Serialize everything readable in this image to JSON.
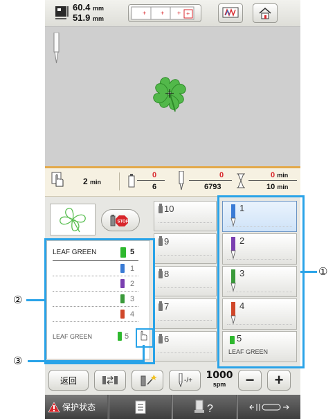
{
  "top_bar": {
    "width": "60.4",
    "height": "51.9",
    "unit": "mm"
  },
  "status_bar": {
    "time_value": "2",
    "time_unit": "min",
    "color_current": "0",
    "color_total": "6",
    "stitch_current": "0",
    "stitch_total": "6793",
    "remaining_current": "0",
    "remaining_unit_top": "min",
    "remaining_total": "10",
    "remaining_unit_bottom": "min"
  },
  "color_list": {
    "header_name": "LEAF GREEN",
    "header_num": "5",
    "rows": [
      {
        "num": "1",
        "color": "#3a7bd5"
      },
      {
        "num": "2",
        "color": "#7a3fb0"
      },
      {
        "num": "3",
        "color": "#3a9a3a"
      },
      {
        "num": "4",
        "color": "#d0472a"
      }
    ],
    "last_name": "LEAF GREEN",
    "last_num": "5"
  },
  "middle_column": [
    "10",
    "9",
    "8",
    "7",
    "6"
  ],
  "right_column": [
    {
      "num": "1",
      "color": "#3a7bd5",
      "label": ""
    },
    {
      "num": "2",
      "color": "#7a3fb0",
      "label": ""
    },
    {
      "num": "3",
      "color": "#3a9a3a",
      "label": ""
    },
    {
      "num": "4",
      "color": "#d0472a",
      "label": ""
    },
    {
      "num": "5",
      "color": "#2eb82e",
      "label": "LEAF GREEN"
    }
  ],
  "bottom_controls": {
    "back_label": "返回",
    "speed_value": "1000",
    "speed_unit": "spm",
    "needle_toggle_label": "-/+",
    "minus_label": "−",
    "plus_label": "+"
  },
  "bottom_bar": {
    "protect_label": "保护状态"
  },
  "callouts": {
    "c1": "①",
    "c2": "②",
    "c3": "③"
  },
  "colors": {
    "selection_blue": "#29a3e8",
    "leaf_green": "#2eb82e",
    "warning_red": "#d8262b"
  }
}
